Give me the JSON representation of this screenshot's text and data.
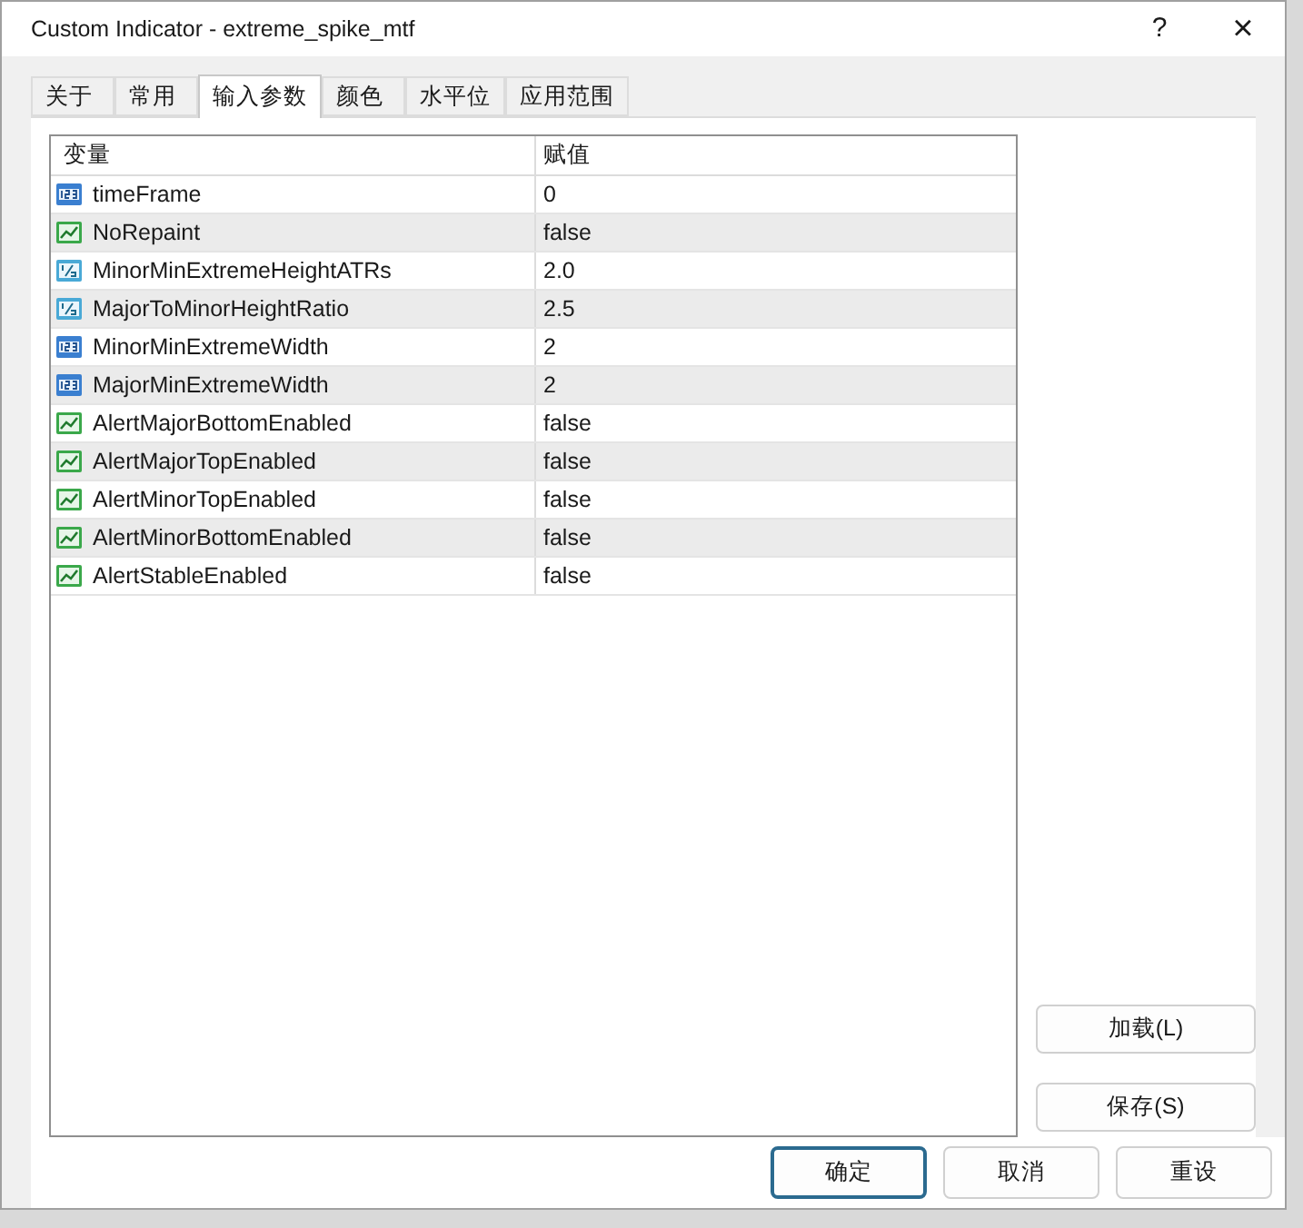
{
  "window": {
    "title": "Custom Indicator - extreme_spike_mtf",
    "help": "?",
    "close": "×"
  },
  "tabs": [
    {
      "label": "关于",
      "selected": false
    },
    {
      "label": "常用",
      "selected": false
    },
    {
      "label": "输入参数",
      "selected": true
    },
    {
      "label": "颜色",
      "selected": false
    },
    {
      "label": "水平位",
      "selected": false
    },
    {
      "label": "应用范围",
      "selected": false
    }
  ],
  "table": {
    "columns": [
      "变量",
      "赋值"
    ],
    "rows": [
      {
        "kind": "int",
        "name": "timeFrame",
        "value": "0"
      },
      {
        "kind": "bool",
        "name": "NoRepaint",
        "value": "false"
      },
      {
        "kind": "double",
        "name": "MinorMinExtremeHeightATRs",
        "value": "2.0"
      },
      {
        "kind": "double",
        "name": "MajorToMinorHeightRatio",
        "value": "2.5"
      },
      {
        "kind": "int",
        "name": "MinorMinExtremeWidth",
        "value": "2"
      },
      {
        "kind": "int",
        "name": "MajorMinExtremeWidth",
        "value": "2"
      },
      {
        "kind": "bool",
        "name": "AlertMajorBottomEnabled",
        "value": "false"
      },
      {
        "kind": "bool",
        "name": "AlertMajorTopEnabled",
        "value": "false"
      },
      {
        "kind": "bool",
        "name": "AlertMinorTopEnabled",
        "value": "false"
      },
      {
        "kind": "bool",
        "name": "AlertMinorBottomEnabled",
        "value": "false"
      },
      {
        "kind": "bool",
        "name": "AlertStableEnabled",
        "value": "false"
      }
    ]
  },
  "side_buttons": [
    "加载(L)",
    "保存(S)"
  ],
  "buttons": [
    {
      "label": "确定",
      "selected": true
    },
    {
      "label": "取消",
      "selected": false
    },
    {
      "label": "重设",
      "selected": false
    }
  ]
}
